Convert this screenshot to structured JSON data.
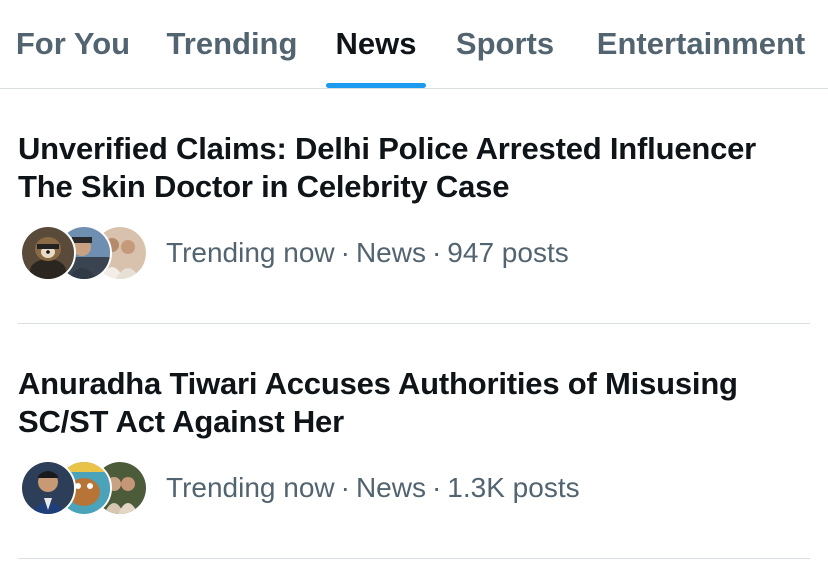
{
  "tabs": [
    {
      "label": "For You"
    },
    {
      "label": "Trending"
    },
    {
      "label": "News"
    },
    {
      "label": "Sports"
    },
    {
      "label": "Entertainment"
    }
  ],
  "active_tab": "News",
  "trends": [
    {
      "title": "Unverified Claims: Delhi Police Arrested Influencer The Skin Doctor in Celebrity Case",
      "status": "Trending now",
      "category": "News",
      "posts": "947 posts"
    },
    {
      "title": "Anuradha Tiwari Accuses Authorities of Misusing SC/ST Act Against Her",
      "status": "Trending now",
      "category": "News",
      "posts": "1.3K posts"
    }
  ],
  "separator": "·",
  "colors": {
    "accent": "#1d9bf0",
    "text_primary": "#0f1419",
    "text_secondary": "#536471",
    "divider": "#d9dee2"
  }
}
